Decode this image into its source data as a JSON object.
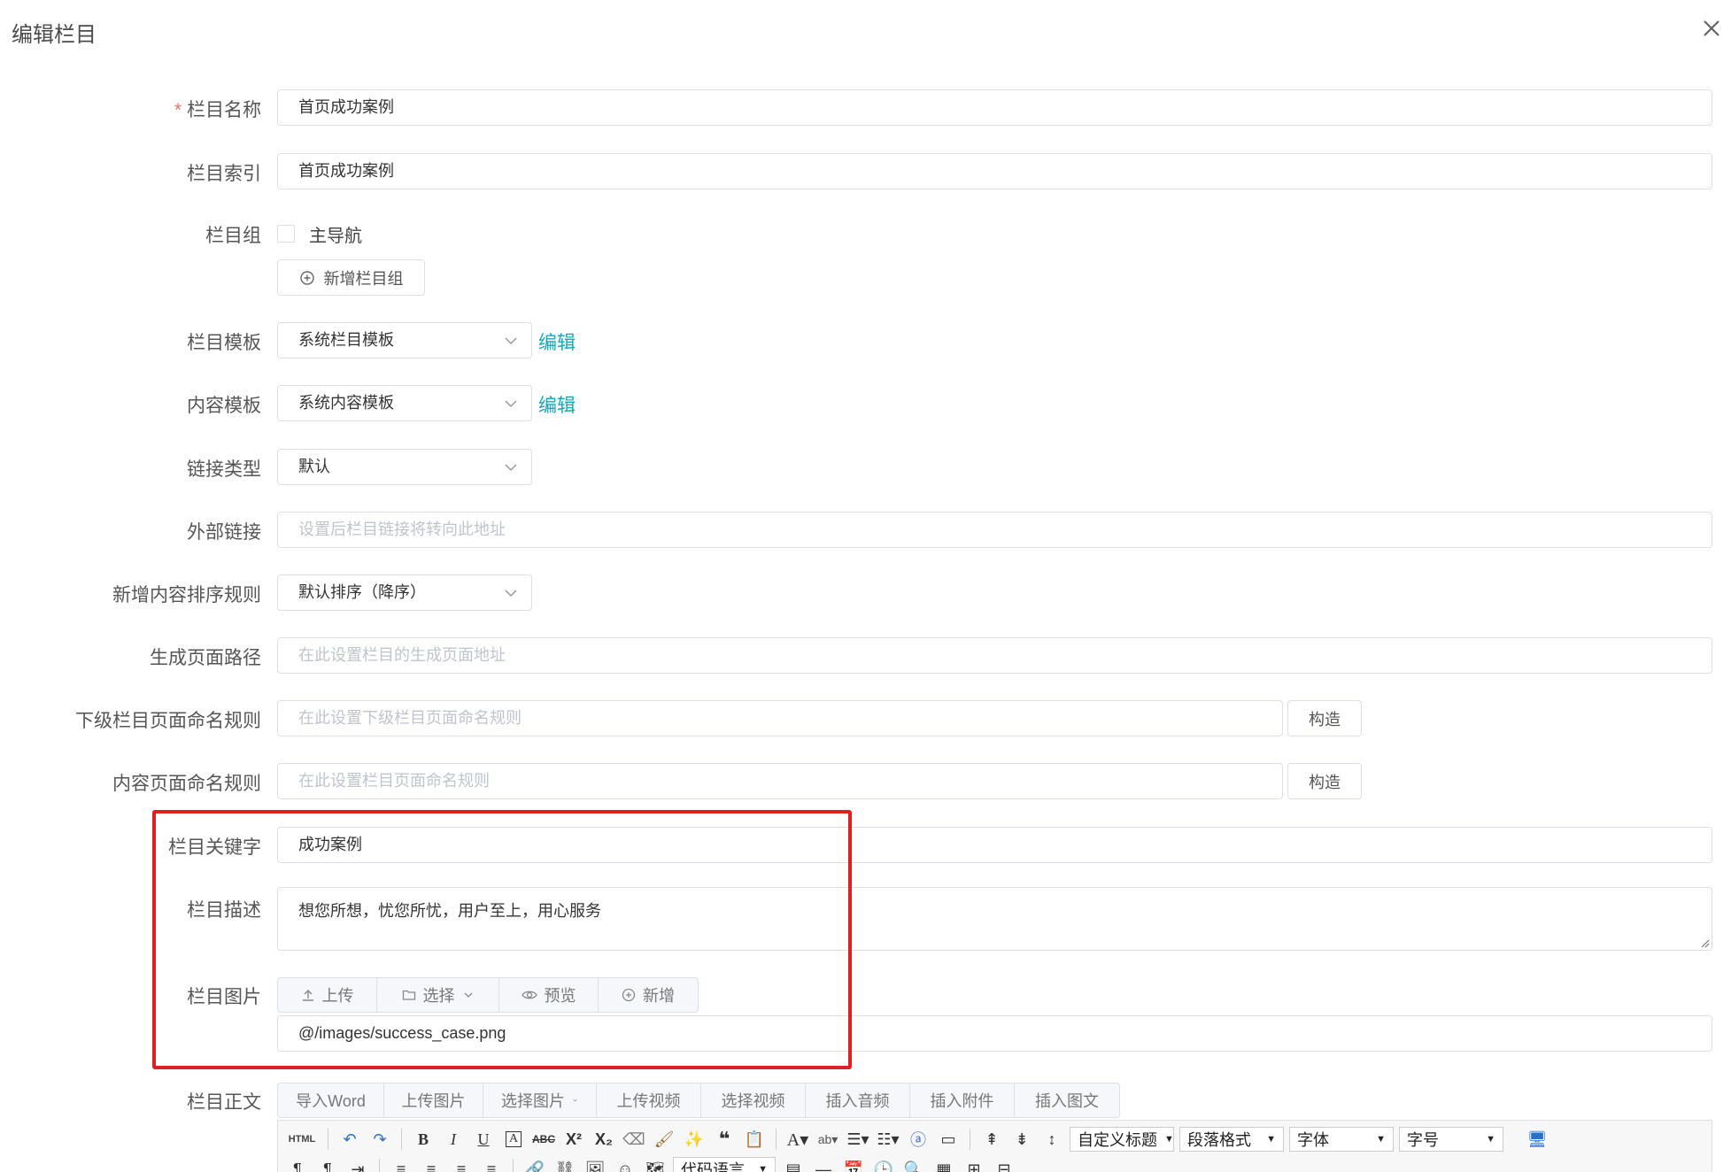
{
  "dialog": {
    "title": "编辑栏目"
  },
  "form": {
    "name": {
      "label": "栏目名称",
      "required_mark": "*",
      "value": "首页成功案例"
    },
    "index": {
      "label": "栏目索引",
      "value": "首页成功案例"
    },
    "group": {
      "label": "栏目组",
      "checkbox_label": "主导航",
      "checked": false,
      "add_button": "新增栏目组"
    },
    "channel_template": {
      "label": "栏目模板",
      "value": "系统栏目模板",
      "edit_link": "编辑"
    },
    "content_template": {
      "label": "内容模板",
      "value": "系统内容模板",
      "edit_link": "编辑"
    },
    "link_type": {
      "label": "链接类型",
      "value": "默认"
    },
    "external_link": {
      "label": "外部链接",
      "placeholder": "设置后栏目链接将转向此地址"
    },
    "sort_rule": {
      "label": "新增内容排序规则",
      "value": "默认排序（降序）"
    },
    "page_path": {
      "label": "生成页面路径",
      "placeholder": "在此设置栏目的生成页面地址"
    },
    "child_naming": {
      "label": "下级栏目页面命名规则",
      "placeholder": "在此设置下级栏目页面命名规则",
      "button": "构造"
    },
    "content_naming": {
      "label": "内容页面命名规则",
      "placeholder": "在此设置栏目页面命名规则",
      "button": "构造"
    },
    "keywords": {
      "label": "栏目关键字",
      "value": "成功案例"
    },
    "description": {
      "label": "栏目描述",
      "value": "想您所想，忧您所忧，用户至上，用心服务"
    },
    "image": {
      "label": "栏目图片",
      "buttons": {
        "upload": "上传",
        "select": "选择",
        "preview": "预览",
        "add": "新增"
      },
      "value": "@/images/success_case.png"
    },
    "body": {
      "label": "栏目正文",
      "buttons": {
        "import_word": "导入Word",
        "upload_image": "上传图片",
        "select_image": "选择图片",
        "upload_video": "上传视频",
        "select_video": "选择视频",
        "insert_audio": "插入音频",
        "insert_attachment": "插入附件",
        "insert_article": "插入图文"
      },
      "toolbar": {
        "html_label": "HTML",
        "custom_heading": "自定义标题",
        "paragraph_format": "段落格式",
        "font_family": "字体",
        "font_size": "字号",
        "code_language": "代码语言"
      }
    }
  },
  "colors": {
    "accent": "#13a8b5",
    "required": "#f56c6c",
    "highlight": "#e02020"
  }
}
